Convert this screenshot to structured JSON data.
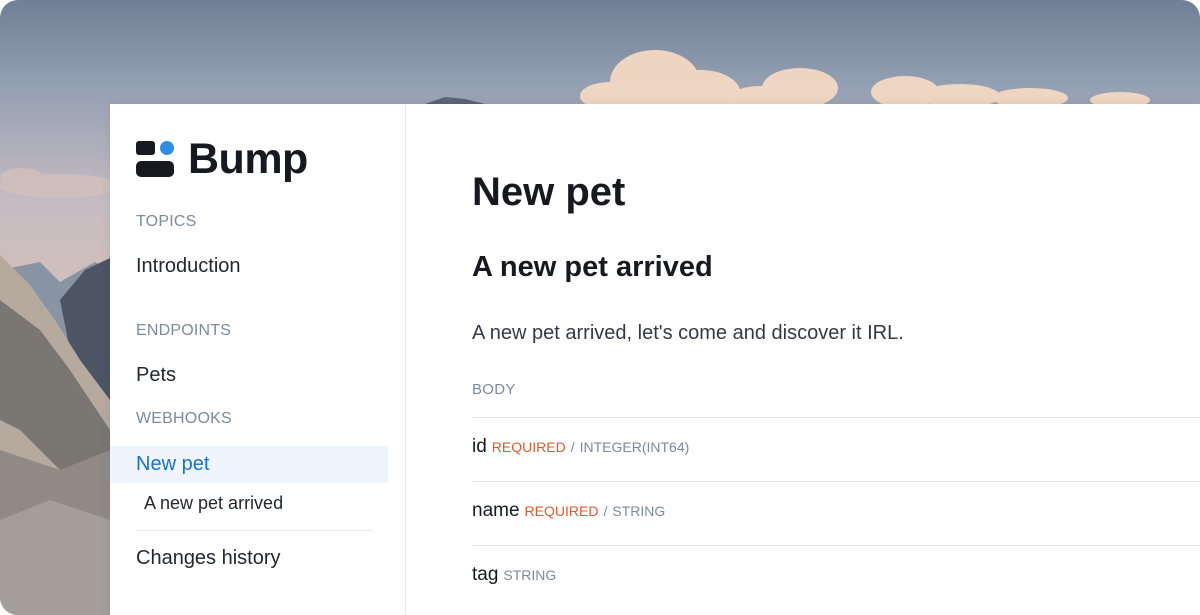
{
  "app": {
    "logo_text": "Bump",
    "accent_color": "#1b6fd1",
    "logo_dot_color": "#2f8de4"
  },
  "sidebar": {
    "topics_heading": "TOPICS",
    "introduction": "Introduction",
    "endpoints_heading": "ENDPOINTS",
    "pets": "Pets",
    "webhooks_heading": "WEBHOOKS",
    "new_pet": "New pet",
    "new_pet_arrived": "A new pet arrived",
    "changes_history": "Changes history"
  },
  "main": {
    "title": "New pet",
    "event_title": "A new pet arrived",
    "description": "A new pet arrived, let's come and discover it IRL.",
    "body_label": "BODY",
    "fields": [
      {
        "name": "id",
        "required": "REQUIRED",
        "separator": "/",
        "type": "INTEGER(INT64)"
      },
      {
        "name": "name",
        "required": "REQUIRED",
        "separator": "/",
        "type": "STRING"
      },
      {
        "name": "tag",
        "type": "STRING"
      }
    ],
    "required_color": "#e2582e"
  }
}
